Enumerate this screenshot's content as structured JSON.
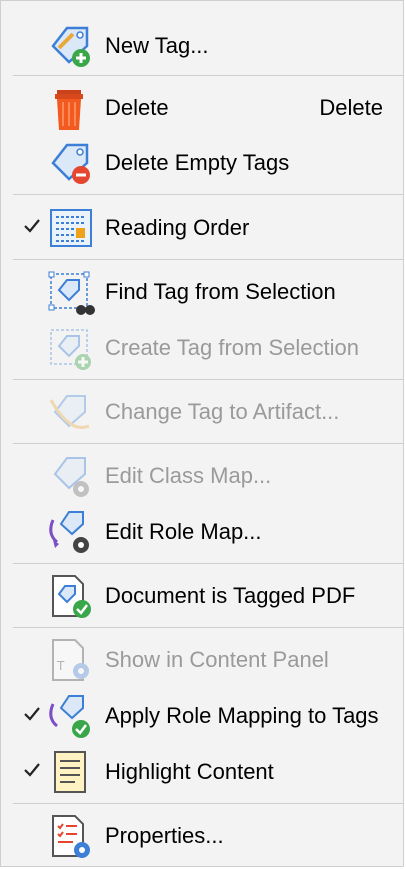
{
  "menu": {
    "items": [
      {
        "label": "New Tag..."
      },
      {
        "label": "Delete",
        "shortcut": "Delete"
      },
      {
        "label": "Delete Empty Tags"
      },
      {
        "label": "Reading Order"
      },
      {
        "label": "Find Tag from Selection"
      },
      {
        "label": "Create Tag from Selection"
      },
      {
        "label": "Change Tag to Artifact..."
      },
      {
        "label": "Edit Class Map..."
      },
      {
        "label": "Edit Role Map..."
      },
      {
        "label": "Document is Tagged PDF"
      },
      {
        "label": "Show in Content Panel"
      },
      {
        "label": "Apply Role Mapping to Tags"
      },
      {
        "label": "Highlight Content"
      },
      {
        "label": "Properties..."
      }
    ]
  },
  "colors": {
    "tag_blue": "#3d7fd6",
    "plus_green": "#3aa64a",
    "minus_red": "#e5462f",
    "trash_orange": "#f25a1f",
    "disabled_text": "#9a9a9a"
  }
}
